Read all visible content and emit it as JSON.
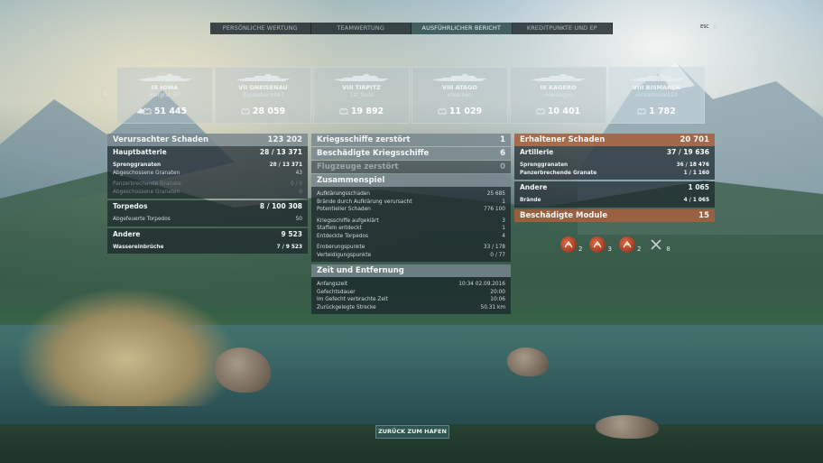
{
  "tabs": [
    {
      "label": "PERSÖNLICHE WERTUNG",
      "active": false
    },
    {
      "label": "TEAMWERTUNG",
      "active": false
    },
    {
      "label": "AUSFÜHRLICHER BERICHT",
      "active": true
    },
    {
      "label": "KREDITPUNKTE UND EP",
      "active": false
    }
  ],
  "esc_label": "ESC",
  "close_glyph": "×",
  "arrows": {
    "left": "‹",
    "right": "›"
  },
  "ships": [
    {
      "name": "IX IOWA",
      "player": "margrat_67",
      "exp": "51 445"
    },
    {
      "name": "VII GNEISENAU",
      "player": "dayseeker1987",
      "exp": "28 059"
    },
    {
      "name": "VIII TIRPITZ",
      "player": "1st_Dela",
      "exp": "19 892"
    },
    {
      "name": "VIII ATAGO",
      "player": "chelchen",
      "exp": "11 029"
    },
    {
      "name": "IX KAGERO",
      "player": "nokulagoo",
      "exp": "10 401"
    },
    {
      "name": "VIII BISMARCK",
      "player": "viceadmiral123",
      "exp": "1 782"
    }
  ],
  "damage": {
    "title": "Verursachter Schaden",
    "total": "123 202",
    "main": {
      "title": "Hauptbatterie",
      "val_a": "28 / ",
      "val_b": "13 371",
      "he": {
        "label": "Sprenggranaten",
        "val_a": "28 / ",
        "val_b": "13 371"
      },
      "he_fired": {
        "label": "Abgeschossene Granaten",
        "val": "43"
      },
      "ap": {
        "label": "Panzerbrechende Granate",
        "val": "0 / 0"
      },
      "ap_fired": {
        "label": "Abgeschossene Granaten",
        "val": "0"
      }
    },
    "torp": {
      "title": "Torpedos",
      "val_a": "8 / ",
      "val_b": "100 308",
      "fired": {
        "label": "Abgefeuerte Torpedos",
        "val": "50"
      }
    },
    "other": {
      "title": "Andere",
      "val": "9 523",
      "flood": {
        "label": "Wassereinbrüche",
        "val_a": "7 / ",
        "val_b": "9 523"
      }
    }
  },
  "mid": {
    "destroyed": {
      "label": "Kriegsschiffe zerstört",
      "val": "1"
    },
    "damaged": {
      "label": "Beschädigte Kriegsschiffe",
      "val": "6"
    },
    "planes": {
      "label": "Flugzeuge zerstört",
      "val": "0"
    },
    "teamplay": {
      "title": "Zusammenspiel",
      "rows1": [
        {
          "label": "Aufklärungsschaden",
          "val": "25 685"
        },
        {
          "label": "Brände durch Aufklärung verursacht",
          "val": "1"
        },
        {
          "label": "Potentieller Schaden",
          "val": "776 100"
        }
      ],
      "rows2": [
        {
          "label": "Kriegsschiffe aufgeklärt",
          "val": "3"
        },
        {
          "label": "Staffeln entdeckt",
          "val": "1"
        },
        {
          "label": "Entdeckte Torpedos",
          "val": "4"
        }
      ],
      "rows3": [
        {
          "label": "Eroberungspunkte",
          "val": "33 / 178"
        },
        {
          "label": "Verteidigungspunkte",
          "val": "0 / 77"
        }
      ]
    },
    "time": {
      "title": "Zeit und Entfernung",
      "rows": [
        {
          "label": "Anfangszeit",
          "val": "10:34  02.09.2016"
        },
        {
          "label": "Gefechtsdauer",
          "val": "20:00"
        },
        {
          "label": "Im Gefecht verbrachte Zeit",
          "val": "10:06"
        },
        {
          "label": "Zurückgelegte Strecke",
          "val": "50.31 km"
        }
      ]
    }
  },
  "received": {
    "title": "Erhaltener Schaden",
    "total": "20 701",
    "art": {
      "title": "Artillerie",
      "val_a": "37 / ",
      "val_b": "19 636",
      "he": {
        "label": "Sprenggranaten",
        "val_a": "36 / ",
        "val_b": "18 476"
      },
      "ap": {
        "label": "Panzerbrechende Granate",
        "val_a": "1 / ",
        "val_b": "1 160"
      }
    },
    "other": {
      "title": "Andere",
      "val": "1 065",
      "fires": {
        "label": "Brände",
        "val_a": "4 / ",
        "val_b": "1 065"
      }
    },
    "modules": {
      "title": "Beschädigte Module",
      "val": "15",
      "items": [
        {
          "icon": "torpedo-module-icon",
          "count": "2"
        },
        {
          "icon": "engine-module-icon",
          "count": "3"
        },
        {
          "icon": "steering-module-icon",
          "count": "2"
        },
        {
          "icon": "aa-module-icon",
          "count": "8"
        }
      ]
    }
  },
  "back_button": "ZURÜCK ZUM HAFEN",
  "colors": {
    "header_grey": "#78868e",
    "header_orange": "#a4603e",
    "tab_active": "#3a5656"
  }
}
